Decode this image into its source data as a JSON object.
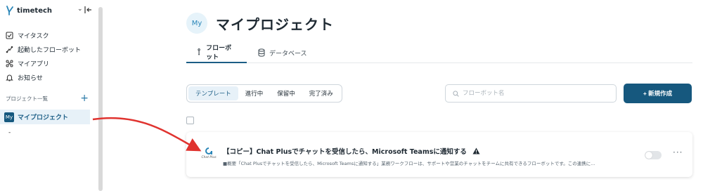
{
  "brand": {
    "name": "timetech",
    "chevron": "⌄"
  },
  "sidebar": {
    "items": [
      {
        "label": "マイタスク",
        "icon": "checkbox-icon"
      },
      {
        "label": "起動したフローボット",
        "icon": "flow-icon"
      },
      {
        "label": "マイアプリ",
        "icon": "apps-icon"
      },
      {
        "label": "お知らせ",
        "icon": "bell-icon"
      }
    ],
    "projects_header": "プロジェクト一覧",
    "add_symbol": "+",
    "project": {
      "badge": "My",
      "label": "マイプロジェクト"
    },
    "dash": "-"
  },
  "main": {
    "badge": "My",
    "title": "マイプロジェクト",
    "tabs": [
      {
        "label": "フローボット",
        "active": true
      },
      {
        "label": "データベース",
        "active": false
      }
    ],
    "filters": [
      {
        "label": "テンプレート",
        "active": true
      },
      {
        "label": "進行中",
        "active": false
      },
      {
        "label": "保留中",
        "active": false
      },
      {
        "label": "完了済み",
        "active": false
      }
    ],
    "search": {
      "placeholder": "フローボット名",
      "value": ""
    },
    "new_button": "+ 新規作成",
    "card": {
      "title": "【コピー】Chat Plusでチャットを受信したら、Microsoft Teamsに通知する",
      "description": "■概要「Chat Plusでチャットを受信したら、Microsoft Teamsに通知する」業務ワークフローは、サポートや営業のチャットをチームに共有できるフローボットです。この連携に...",
      "logo_text": "Chat Plus",
      "toggle_on": false,
      "more": "···"
    }
  },
  "colors": {
    "accent": "#16587e",
    "selected_bg": "#e7f1f8",
    "arrow": "#e0332f"
  }
}
